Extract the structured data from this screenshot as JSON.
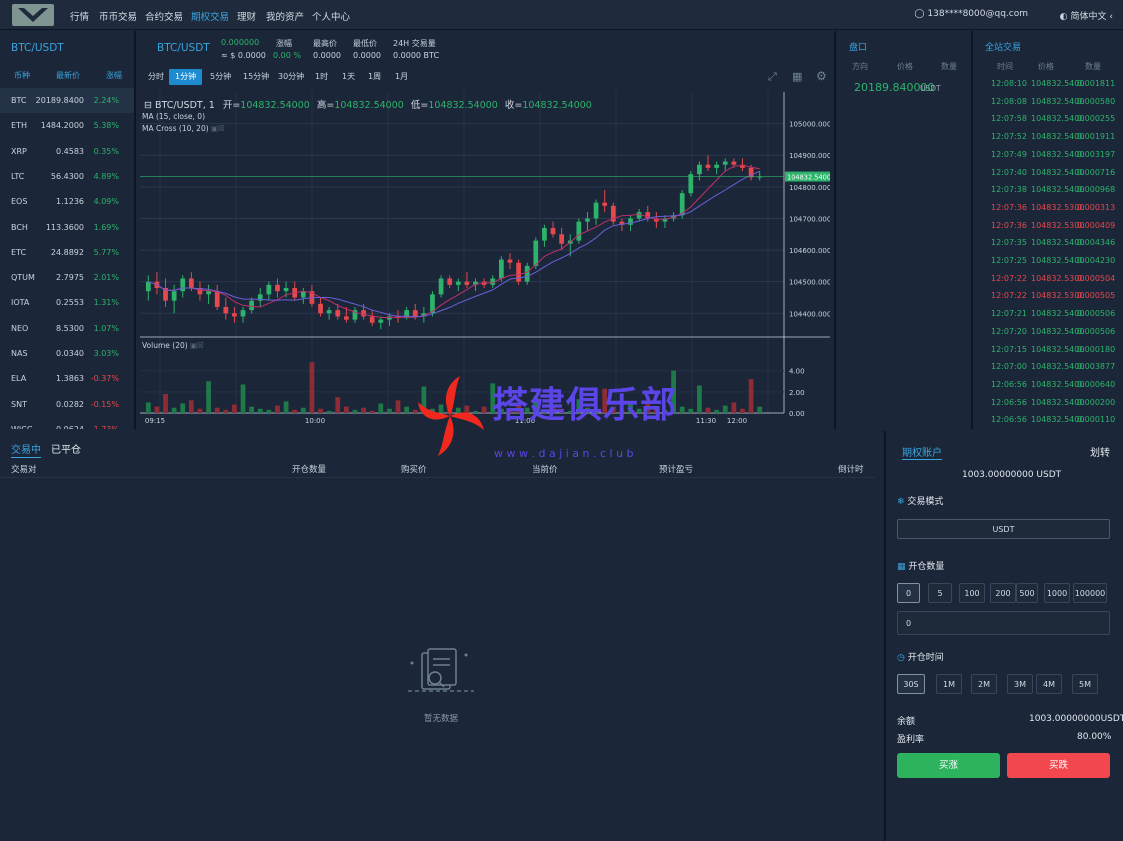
{
  "nav": {
    "items": [
      "行情",
      "币币交易",
      "合约交易",
      "期权交易",
      "理财",
      "我的资产",
      "个人中心"
    ],
    "active_index": 3,
    "user": "138****8000@qq.com",
    "lang": "简体中文"
  },
  "market": {
    "title": "BTC/USDT",
    "headers": [
      "币种",
      "最新价",
      "涨幅"
    ],
    "rows": [
      {
        "sym": "BTC",
        "price": "20189.8400",
        "chg": "2.24%",
        "dir": "up"
      },
      {
        "sym": "ETH",
        "price": "1484.2000",
        "chg": "5.38%",
        "dir": "up"
      },
      {
        "sym": "XRP",
        "price": "0.4583",
        "chg": "0.35%",
        "dir": "up"
      },
      {
        "sym": "LTC",
        "price": "56.4300",
        "chg": "4.89%",
        "dir": "up"
      },
      {
        "sym": "EOS",
        "price": "1.1236",
        "chg": "4.09%",
        "dir": "up"
      },
      {
        "sym": "BCH",
        "price": "113.3600",
        "chg": "1.69%",
        "dir": "up"
      },
      {
        "sym": "ETC",
        "price": "24.8892",
        "chg": "5.77%",
        "dir": "up"
      },
      {
        "sym": "QTUM",
        "price": "2.7975",
        "chg": "2.01%",
        "dir": "up"
      },
      {
        "sym": "IOTA",
        "price": "0.2553",
        "chg": "1.31%",
        "dir": "up"
      },
      {
        "sym": "NEO",
        "price": "8.5300",
        "chg": "1.07%",
        "dir": "up"
      },
      {
        "sym": "NAS",
        "price": "0.0340",
        "chg": "3.03%",
        "dir": "up"
      },
      {
        "sym": "ELA",
        "price": "1.3863",
        "chg": "-0.37%",
        "dir": "down"
      },
      {
        "sym": "SNT",
        "price": "0.0282",
        "chg": "-0.15%",
        "dir": "down"
      },
      {
        "sym": "WICC",
        "price": "0.0624",
        "chg": "-1.73%",
        "dir": "down"
      }
    ]
  },
  "ticker": {
    "pair": "BTC/USDT",
    "price": "0.000000",
    "approx": "≈ $ 0.0000",
    "chg_label": "涨幅",
    "chg_value": "0.00 %",
    "high_label": "最高价",
    "high_value": "0.0000",
    "low_label": "最低价",
    "low_value": "0.0000",
    "vol_label": "24H 交易量",
    "vol_value": "0.0000 BTC"
  },
  "intervals": [
    "分时",
    "1分钟",
    "5分钟",
    "15分钟",
    "30分钟",
    "1时",
    "1天",
    "1周",
    "1月"
  ],
  "interval_active": 1,
  "chart_info": {
    "symbol": "BTC/USDT, 1",
    "open_label": "开=",
    "open": "104832.54000",
    "high_label": "高=",
    "high": "104832.54000",
    "low_label": "低=",
    "low": "104832.54000",
    "close_label": "收=",
    "close": "104832.54000",
    "ma1": "MA (15, close, 0)",
    "ma2": "MA Cross (10, 20)",
    "vol_title": "Volume (20)",
    "last_price_tag": "104832.54000"
  },
  "chart_data": {
    "type": "candlestick",
    "y_ticks": [
      "105000.00000",
      "104900.00000",
      "104800.00000",
      "104700.00000",
      "104600.00000",
      "104500.00000",
      "104400.00000"
    ],
    "y_range": [
      104325,
      105100
    ],
    "vol_ticks": [
      "4.00",
      "2.00",
      "0.00"
    ],
    "x_ticks": [
      "09:15",
      "10:00",
      "11:00",
      "11:30",
      "12:00"
    ],
    "candles": [
      [
        104470,
        104520,
        104440,
        104500
      ],
      [
        104500,
        104530,
        104460,
        104480
      ],
      [
        104480,
        104510,
        104420,
        104440
      ],
      [
        104440,
        104490,
        104400,
        104470
      ],
      [
        104470,
        104520,
        104450,
        104510
      ],
      [
        104510,
        104530,
        104470,
        104480
      ],
      [
        104480,
        104500,
        104440,
        104460
      ],
      [
        104460,
        104490,
        104430,
        104470
      ],
      [
        104470,
        104490,
        104410,
        104420
      ],
      [
        104420,
        104450,
        104380,
        104400
      ],
      [
        104400,
        104420,
        104370,
        104390
      ],
      [
        104390,
        104420,
        104370,
        104410
      ],
      [
        104410,
        104450,
        104400,
        104440
      ],
      [
        104440,
        104480,
        104420,
        104460
      ],
      [
        104460,
        104500,
        104440,
        104490
      ],
      [
        104490,
        104510,
        104450,
        104470
      ],
      [
        104470,
        104500,
        104450,
        104480
      ],
      [
        104480,
        104500,
        104440,
        104450
      ],
      [
        104450,
        104480,
        104430,
        104470
      ],
      [
        104470,
        104490,
        104420,
        104430
      ],
      [
        104430,
        104450,
        104390,
        104400
      ],
      [
        104400,
        104420,
        104380,
        104410
      ],
      [
        104410,
        104430,
        104380,
        104390
      ],
      [
        104390,
        104420,
        104370,
        104380
      ],
      [
        104380,
        104420,
        104370,
        104410
      ],
      [
        104410,
        104430,
        104380,
        104390
      ],
      [
        104390,
        104410,
        104360,
        104370
      ],
      [
        104370,
        104390,
        104350,
        104380
      ],
      [
        104380,
        104400,
        104360,
        104390
      ],
      [
        104390,
        104410,
        104370,
        104385
      ],
      [
        104385,
        104420,
        104380,
        104410
      ],
      [
        104410,
        104430,
        104380,
        104390
      ],
      [
        104390,
        104420,
        104370,
        104400
      ],
      [
        104400,
        104470,
        104390,
        104460
      ],
      [
        104460,
        104520,
        104450,
        104510
      ],
      [
        104510,
        104520,
        104480,
        104490
      ],
      [
        104490,
        104510,
        104470,
        104500
      ],
      [
        104500,
        104530,
        104480,
        104490
      ],
      [
        104490,
        104510,
        104470,
        104500
      ],
      [
        104500,
        104510,
        104480,
        104490
      ],
      [
        104490,
        104520,
        104480,
        104510
      ],
      [
        104510,
        104580,
        104500,
        104570
      ],
      [
        104570,
        104590,
        104540,
        104560
      ],
      [
        104560,
        104570,
        104490,
        104500
      ],
      [
        104500,
        104560,
        104490,
        104550
      ],
      [
        104550,
        104640,
        104540,
        104630
      ],
      [
        104630,
        104680,
        104610,
        104670
      ],
      [
        104670,
        104690,
        104640,
        104650
      ],
      [
        104650,
        104670,
        104600,
        104620
      ],
      [
        104620,
        104650,
        104580,
        104630
      ],
      [
        104630,
        104700,
        104620,
        104690
      ],
      [
        104690,
        104720,
        104660,
        104700
      ],
      [
        104700,
        104760,
        104680,
        104750
      ],
      [
        104750,
        104790,
        104720,
        104740
      ],
      [
        104740,
        104750,
        104680,
        104690
      ],
      [
        104690,
        104700,
        104660,
        104680
      ],
      [
        104680,
        104710,
        104660,
        104700
      ],
      [
        104700,
        104730,
        104690,
        104720
      ],
      [
        104720,
        104740,
        104690,
        104700
      ],
      [
        104700,
        104720,
        104670,
        104690
      ],
      [
        104690,
        104710,
        104670,
        104700
      ],
      [
        104700,
        104720,
        104690,
        104710
      ],
      [
        104710,
        104790,
        104700,
        104780
      ],
      [
        104780,
        104850,
        104770,
        104840
      ],
      [
        104840,
        104880,
        104820,
        104870
      ],
      [
        104870,
        104900,
        104850,
        104860
      ],
      [
        104860,
        104880,
        104840,
        104870
      ],
      [
        104870,
        104890,
        104850,
        104880
      ],
      [
        104880,
        104890,
        104860,
        104870
      ],
      [
        104870,
        104890,
        104850,
        104860
      ],
      [
        104860,
        104870,
        104820,
        104830
      ],
      [
        104830,
        104850,
        104820,
        104832.54
      ]
    ],
    "volumes": [
      1.0,
      0.6,
      1.8,
      0.5,
      0.9,
      1.2,
      0.4,
      3.0,
      0.5,
      0.3,
      0.8,
      2.7,
      0.6,
      0.4,
      0.3,
      0.7,
      1.1,
      0.3,
      0.5,
      4.8,
      0.4,
      0.2,
      1.5,
      0.6,
      0.3,
      0.5,
      0.2,
      0.9,
      0.4,
      1.2,
      0.6,
      0.3,
      2.5,
      0.4,
      0.8,
      0.3,
      0.5,
      0.7,
      0.2,
      0.6,
      2.8,
      0.4,
      0.3,
      0.9,
      0.5,
      1.6,
      0.3,
      0.7,
      0.4,
      0.2,
      1.3,
      0.5,
      0.4,
      2.3,
      0.6,
      0.3,
      0.8,
      0.4,
      1.0,
      0.5,
      0.3,
      4.0,
      0.6,
      0.4,
      2.6,
      0.5,
      0.3,
      0.7,
      1.0,
      0.4,
      3.2,
      0.6
    ],
    "last_price": 104832.54
  },
  "book": {
    "title": "盘口",
    "headers": [
      "方向",
      "价格",
      "数量"
    ],
    "price": "20189.840000",
    "unit": "USDT"
  },
  "trades": {
    "title": "全站交易",
    "headers": [
      "时间",
      "价格",
      "数量"
    ],
    "rows": [
      {
        "t": "12:08:10",
        "p": "104832.5400",
        "q": "0.001811",
        "dir": "up"
      },
      {
        "t": "12:08:08",
        "p": "104832.5400",
        "q": "0.000580",
        "dir": "up"
      },
      {
        "t": "12:07:58",
        "p": "104832.5400",
        "q": "0.000255",
        "dir": "up"
      },
      {
        "t": "12:07:52",
        "p": "104832.5400",
        "q": "0.001911",
        "dir": "up"
      },
      {
        "t": "12:07:49",
        "p": "104832.5400",
        "q": "0.003197",
        "dir": "up"
      },
      {
        "t": "12:07:40",
        "p": "104832.5400",
        "q": "0.000716",
        "dir": "up"
      },
      {
        "t": "12:07:38",
        "p": "104832.5400",
        "q": "0.000968",
        "dir": "up"
      },
      {
        "t": "12:07:36",
        "p": "104832.5300",
        "q": "0.000313",
        "dir": "down"
      },
      {
        "t": "12:07:36",
        "p": "104832.5300",
        "q": "0.000409",
        "dir": "down"
      },
      {
        "t": "12:07:35",
        "p": "104832.5400",
        "q": "0.004346",
        "dir": "up"
      },
      {
        "t": "12:07:25",
        "p": "104832.5400",
        "q": "0.004230",
        "dir": "up"
      },
      {
        "t": "12:07:22",
        "p": "104832.5300",
        "q": "0.000504",
        "dir": "down"
      },
      {
        "t": "12:07:22",
        "p": "104832.5300",
        "q": "0.000505",
        "dir": "down"
      },
      {
        "t": "12:07:21",
        "p": "104832.5400",
        "q": "0.000506",
        "dir": "up"
      },
      {
        "t": "12:07:20",
        "p": "104832.5400",
        "q": "0.000506",
        "dir": "up"
      },
      {
        "t": "12:07:15",
        "p": "104832.5400",
        "q": "0.000180",
        "dir": "up"
      },
      {
        "t": "12:07:00",
        "p": "104832.5400",
        "q": "0.003877",
        "dir": "up"
      },
      {
        "t": "12:06:56",
        "p": "104832.5400",
        "q": "0.000640",
        "dir": "up"
      },
      {
        "t": "12:06:56",
        "p": "104832.5400",
        "q": "0.000200",
        "dir": "up"
      },
      {
        "t": "12:06:56",
        "p": "104832.5400",
        "q": "0.000110",
        "dir": "up"
      }
    ]
  },
  "orders": {
    "tab_active": "交易中",
    "tab_other": "已平仓",
    "headers": [
      "交易对",
      "开仓数量",
      "购买价",
      "当前价",
      "预计盈亏",
      "倒计时"
    ],
    "empty": "暂无数据"
  },
  "account": {
    "title": "期权账户",
    "transfer": "划转",
    "balance": "1003.00000000 USDT",
    "mode_label": "交易模式",
    "mode_value": "USDT",
    "qty_label": "开仓数量",
    "qty_options": [
      "0",
      "5",
      "100",
      "200",
      "500",
      "1000",
      "100000"
    ],
    "qty_input": "0",
    "time_label": "开仓时间",
    "time_options": [
      "30S",
      "1M",
      "2M",
      "3M",
      "4M",
      "5M"
    ],
    "bal_label": "余额",
    "bal_value": "1003.00000000USDT",
    "rate_label": "盈利率",
    "rate_value": "80.00%",
    "buy_up": "买涨",
    "buy_down": "买跌"
  },
  "watermark": {
    "title": "搭建俱乐部",
    "sub": "w w w . d a j i a n . c l u b"
  },
  "colors": {
    "up": "#2db36b",
    "down": "#e5484d",
    "accent": "#3aa4de"
  }
}
